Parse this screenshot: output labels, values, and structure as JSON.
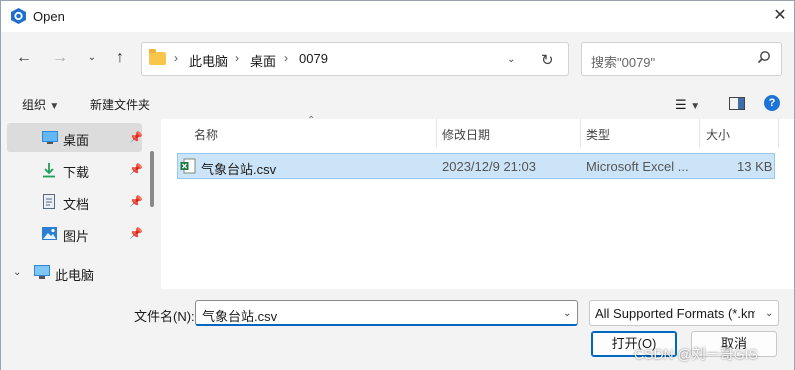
{
  "window": {
    "title": "Open"
  },
  "address": {
    "crumbs": [
      "此电脑",
      "桌面",
      "0079"
    ],
    "search_placeholder": "搜索\"0079\""
  },
  "commands": {
    "organize": "组织",
    "new_folder": "新建文件夹"
  },
  "nav": {
    "items": [
      {
        "label": "桌面",
        "icon": "desktop-icon",
        "pinned": true,
        "selected": true
      },
      {
        "label": "下载",
        "icon": "download-icon",
        "pinned": true
      },
      {
        "label": "文档",
        "icon": "document-icon",
        "pinned": true
      },
      {
        "label": "图片",
        "icon": "picture-icon",
        "pinned": true
      },
      {
        "label": "此电脑",
        "icon": "computer-icon",
        "expanded": true
      }
    ]
  },
  "columns": {
    "name": "名称",
    "modified": "修改日期",
    "type": "类型",
    "size": "大小"
  },
  "files": [
    {
      "name": "气象台站.csv",
      "modified": "2023/12/9 21:03",
      "type": "Microsoft Excel ...",
      "size": "13 KB",
      "icon": "excel-file-icon"
    }
  ],
  "footer": {
    "filename_label": "文件名(N):",
    "filename_value": "气象台站.csv",
    "filetype_value": "All Supported Formats (*.kml",
    "open_label": "打开(O)",
    "cancel_label": "取消"
  },
  "watermark": "CSDN @刘一哥GIS",
  "colors": {
    "accent": "#0067c0",
    "selection": "#cce4f7",
    "help": "#1e73d6"
  }
}
